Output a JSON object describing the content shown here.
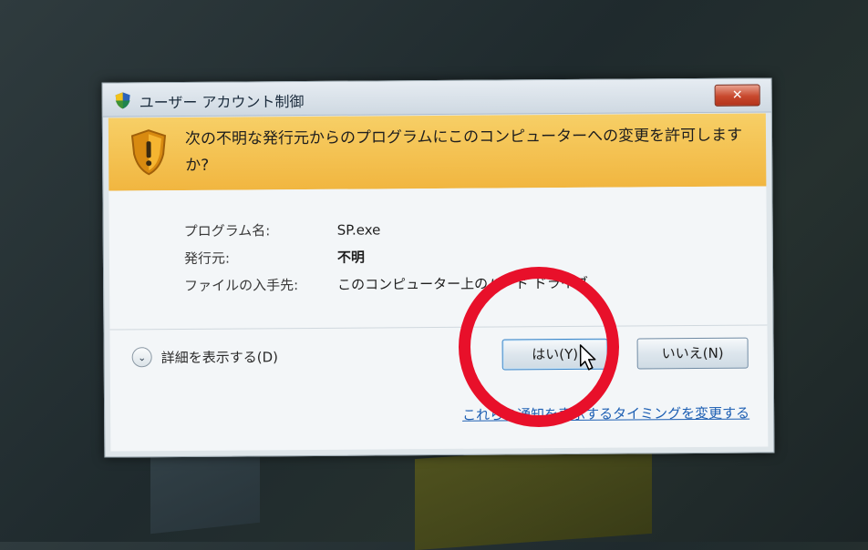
{
  "window": {
    "title": "ユーザー アカウント制御",
    "close_label": "✕"
  },
  "banner": {
    "question": "次の不明な発行元からのプログラムにこのコンピューターへの変更を許可しますか?"
  },
  "info": {
    "program_label": "プログラム名:",
    "program_value": "SP.exe",
    "publisher_label": "発行元:",
    "publisher_value": "不明",
    "origin_label": "ファイルの入手先:",
    "origin_value": "このコンピューター上のハード ドライブ"
  },
  "details": {
    "label": "詳細を表示する(D)",
    "chevron": "⌄"
  },
  "buttons": {
    "yes": "はい(Y)",
    "no": "いいえ(N)"
  },
  "link": {
    "text": "これらの通知を表示するタイミングを変更する"
  },
  "colors": {
    "banner": "#f1b640",
    "highlight": "#e8102a",
    "link": "#1d5fb3"
  }
}
